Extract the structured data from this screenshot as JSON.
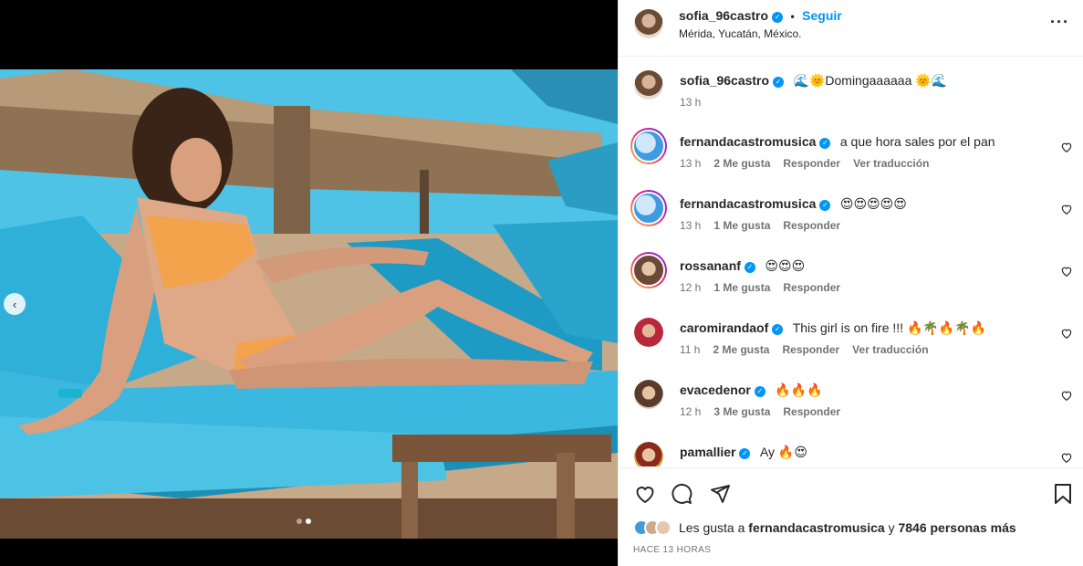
{
  "post": {
    "username": "sofia_96castro",
    "follow_label": "Seguir",
    "separator": "•",
    "location": "Mérida, Yucatán, México.",
    "caption_emoji_before": "🌊🌞",
    "caption_text": "Domingaaaaaa",
    "caption_emoji_after": " 🌞🌊",
    "caption_time": "13 h",
    "more_icon": "more-options-icon",
    "carousel_active_index": 2,
    "carousel_total": 2
  },
  "comments": [
    {
      "username": "fernandacastromusica",
      "text": "a que hora sales por el pan",
      "time": "13 h",
      "likes": "2 Me gusta",
      "reply": "Responder",
      "translate": "Ver traducción"
    },
    {
      "username": "fernandacastromusica",
      "text": "😍😍😍😍😍",
      "time": "13 h",
      "likes": "1 Me gusta",
      "reply": "Responder",
      "translate": ""
    },
    {
      "username": "rossananf",
      "text": "😍😍😍",
      "time": "12 h",
      "likes": "1 Me gusta",
      "reply": "Responder",
      "translate": ""
    },
    {
      "username": "caromirandaof",
      "text": "This girl is on fire !!! 🔥🌴🔥🌴🔥",
      "time": "11 h",
      "likes": "2 Me gusta",
      "reply": "Responder",
      "translate": "Ver traducción"
    },
    {
      "username": "evacedenor",
      "text": "🔥🔥🔥",
      "time": "12 h",
      "likes": "3 Me gusta",
      "reply": "Responder",
      "translate": ""
    },
    {
      "username": "pamallier",
      "text": "Ay 🔥😍",
      "time": "",
      "likes": "",
      "reply": "",
      "translate": ""
    }
  ],
  "footer": {
    "likes_prefix": "Les gusta a ",
    "likes_user": "fernandacastromusica",
    "likes_middle": " y ",
    "likes_count": "7846 personas más",
    "posted_ago": "HACE 13 HORAS"
  },
  "colors": {
    "accent": "#0095f6",
    "text": "#262626",
    "muted": "#737373",
    "divider": "#efefef"
  }
}
